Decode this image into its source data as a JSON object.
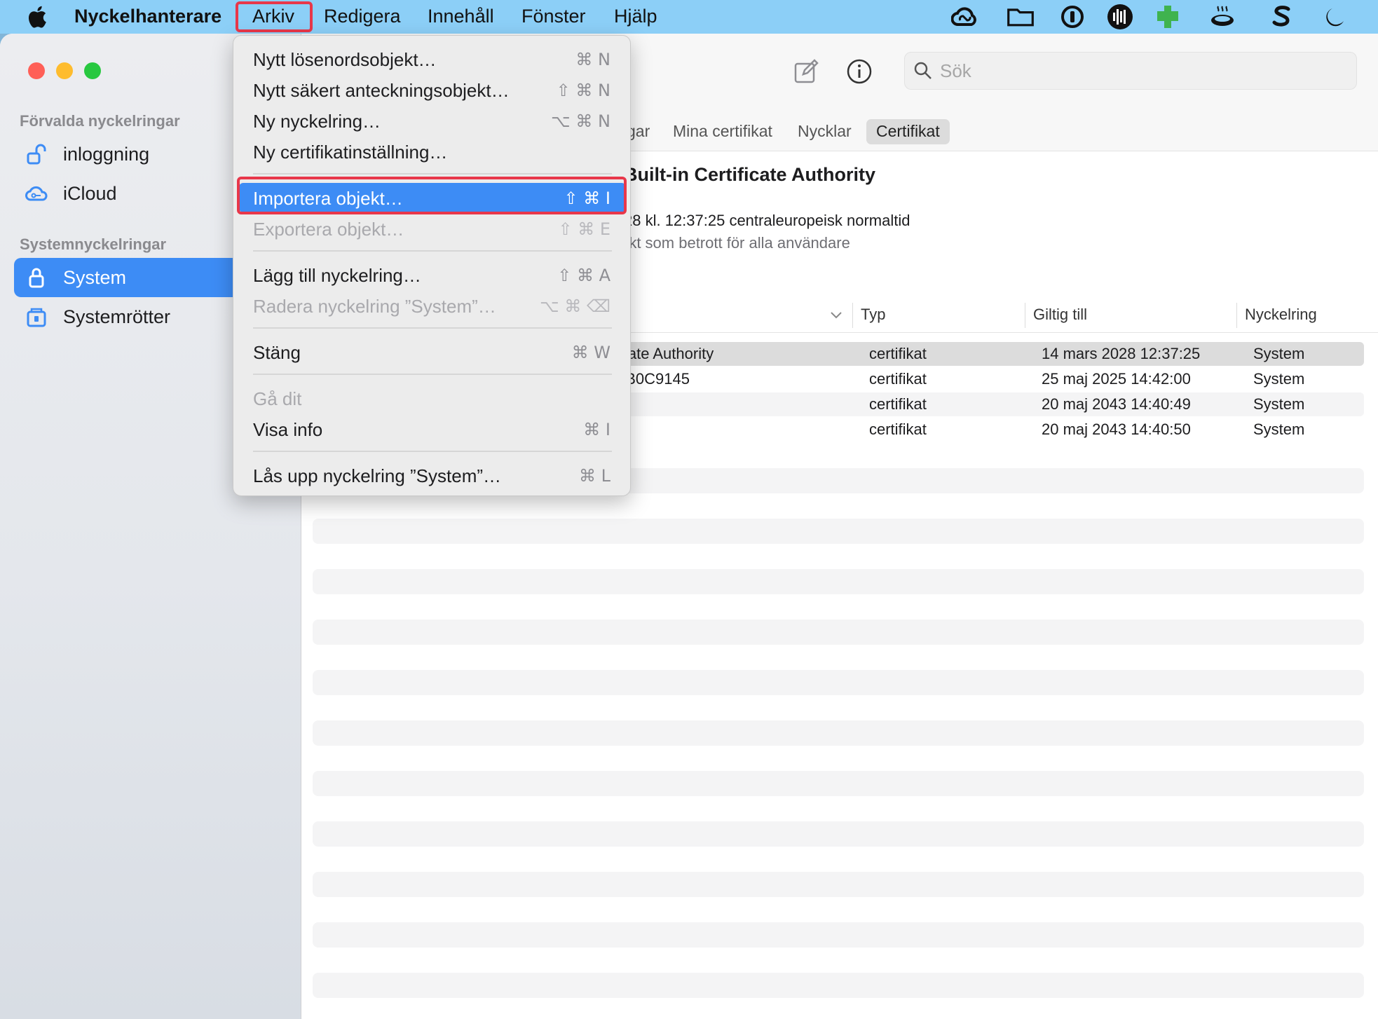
{
  "menubar": {
    "app_name": "Nyckelhanterare",
    "items": [
      "Arkiv",
      "Redigera",
      "Innehåll",
      "Fönster",
      "Hjälp"
    ],
    "tray_icons": [
      "creative-cloud-icon",
      "folder-icon",
      "1password-icon",
      "audio-waveform-icon",
      "green-puzzle-icon",
      "coffee-cup-icon",
      "s-logo-icon",
      "moon-icon"
    ]
  },
  "sidebar": {
    "section_default": "Förvalda nyckelringar",
    "default_items": [
      {
        "label": "inloggning",
        "icon": "unlocked-padlock-icon"
      },
      {
        "label": "iCloud",
        "icon": "icloud-icon"
      }
    ],
    "section_system": "Systemnyckelringar",
    "system_items": [
      {
        "label": "System",
        "icon": "padlock-icon",
        "selected": true
      },
      {
        "label": "Systemrötter",
        "icon": "cabinet-icon"
      }
    ]
  },
  "toolbar": {
    "search_placeholder": "Sök"
  },
  "tabs": [
    {
      "label": "gar",
      "active": false
    },
    {
      "label": "Mina certifikat",
      "active": false
    },
    {
      "label": "Nycklar",
      "active": false
    },
    {
      "label": "Certifikat",
      "active": true
    }
  ],
  "detail": {
    "title": "Built-in Certificate Authority",
    "line1": "28 kl. 12:37:25 centraleuropeisk normaltid",
    "line2": "rkt som betrott för alla användare"
  },
  "table": {
    "columns": [
      "Typ",
      "Giltig till",
      "Nyckelring"
    ],
    "rows": [
      {
        "name": "icate Authority",
        "type": "certifikat",
        "valid_until": "14 mars 2028 12:37:25",
        "keychain": "System"
      },
      {
        "name": "0B0C9145",
        "type": "certifikat",
        "valid_until": "25 maj 2025 14:42:00",
        "keychain": "System"
      },
      {
        "name": "",
        "type": "certifikat",
        "valid_until": "20 maj 2043 14:40:49",
        "keychain": "System"
      },
      {
        "name": "",
        "type": "certifikat",
        "valid_until": "20 maj 2043 14:40:50",
        "keychain": "System"
      }
    ]
  },
  "file_menu": {
    "items": [
      {
        "label": "Nytt lösenordsobjekt…",
        "shortcut": "⌘ N",
        "disabled": false
      },
      {
        "label": "Nytt säkert anteckningsobjekt…",
        "shortcut": "⇧ ⌘ N",
        "disabled": false
      },
      {
        "label": "Ny nyckelring…",
        "shortcut": "⌥ ⌘ N",
        "disabled": false
      },
      {
        "label": "Ny certifikatinställning…",
        "shortcut": "",
        "disabled": false
      },
      {
        "label": "Importera objekt…",
        "shortcut": "⇧ ⌘  I",
        "disabled": false,
        "highlighted": true
      },
      {
        "label": "Exportera objekt…",
        "shortcut": "⇧ ⌘ E",
        "disabled": true
      },
      {
        "label": "Lägg till nyckelring…",
        "shortcut": "⇧ ⌘ A",
        "disabled": false
      },
      {
        "label": "Radera nyckelring ”System”…",
        "shortcut": "⌥ ⌘ ⌫",
        "disabled": true
      },
      {
        "label": "Stäng",
        "shortcut": "⌘ W",
        "disabled": false
      },
      {
        "label": "Gå dit",
        "shortcut": "",
        "disabled": true
      },
      {
        "label": "Visa info",
        "shortcut": "⌘  I",
        "disabled": false
      },
      {
        "label": "Lås upp nyckelring ”System”…",
        "shortcut": "⌘ L",
        "disabled": false
      }
    ]
  },
  "colors": {
    "menubar_bg": "#8ccff7",
    "accent": "#3d8cf5",
    "highlight_box": "#e8374a"
  }
}
